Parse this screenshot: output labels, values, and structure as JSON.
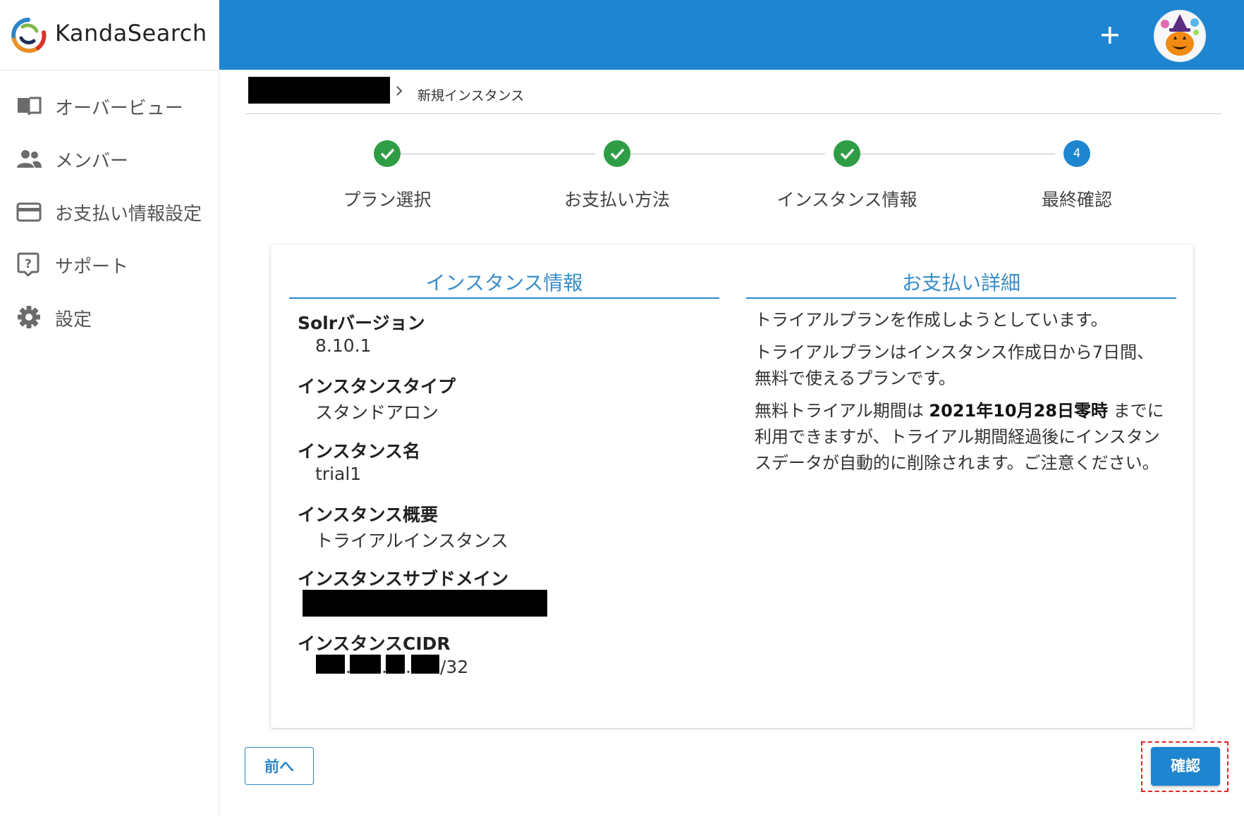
{
  "app": {
    "name": "KandaSearch",
    "brand_color": "#1e86d0",
    "success_color": "#2e9d45"
  },
  "sidebar": {
    "items": [
      {
        "label": "オーバービュー",
        "icon": "book-icon"
      },
      {
        "label": "メンバー",
        "icon": "people-icon"
      },
      {
        "label": "お支払い情報設定",
        "icon": "credit-card-icon"
      },
      {
        "label": "サポート",
        "icon": "help-icon"
      },
      {
        "label": "設定",
        "icon": "gear-icon"
      }
    ]
  },
  "header": {
    "add_icon": "plus-icon",
    "avatar_icon": "pumpkin-avatar"
  },
  "breadcrumb": {
    "current": "新規インスタンス"
  },
  "stepper": {
    "steps": [
      {
        "label": "プラン選択",
        "state": "done"
      },
      {
        "label": "お支払い方法",
        "state": "done"
      },
      {
        "label": "インスタンス情報",
        "state": "done"
      },
      {
        "label": "最終確認",
        "state": "active",
        "number": "4"
      }
    ]
  },
  "instance_info": {
    "title": "インスタンス情報",
    "fields": [
      {
        "label": "Solrバージョン",
        "value": "8.10.1"
      },
      {
        "label": "インスタンスタイプ",
        "value": "スタンドアロン"
      },
      {
        "label": "インスタンス名",
        "value": "trial1"
      },
      {
        "label": "インスタンス概要",
        "value": "トライアルインスタンス"
      },
      {
        "label": "インスタンスサブドメイン",
        "value": ""
      },
      {
        "label": "インスタンスCIDR",
        "value_suffix": "/32",
        "separator": "."
      }
    ]
  },
  "payment_details": {
    "title": "お支払い詳細",
    "line1": "トライアルプランを作成しようとしています。",
    "line2": "トライアルプランはインスタンス作成日から7日間、無料で使えるプランです。",
    "line3_prefix": "無料トライアル期間は ",
    "line3_date": "2021年10月28日零時",
    "line3_suffix": " までに利用できますが、トライアル期間経過後にインスタンスデータが自動的に削除されます。ご注意ください。"
  },
  "actions": {
    "prev_label": "前へ",
    "confirm_label": "確認"
  }
}
